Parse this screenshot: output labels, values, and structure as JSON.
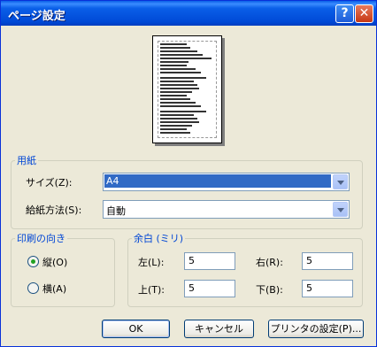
{
  "window": {
    "title": "ページ設定"
  },
  "titlebar": {
    "help_glyph": "?",
    "close_glyph": "✕"
  },
  "paper": {
    "legend": "用紙",
    "size_label": "サイズ(Z):",
    "size_value": "A4",
    "source_label": "給紙方法(S):",
    "source_value": "自動"
  },
  "orientation": {
    "legend": "印刷の向き",
    "portrait_label": "縦(O)",
    "landscape_label": "横(A)",
    "selected": "portrait"
  },
  "margins": {
    "legend": "余白 (ミリ)",
    "left_label": "左(L):",
    "left_value": "5",
    "right_label": "右(R):",
    "right_value": "5",
    "top_label": "上(T):",
    "top_value": "5",
    "bottom_label": "下(B):",
    "bottom_value": "5"
  },
  "buttons": {
    "ok": "OK",
    "cancel": "キャンセル",
    "printer": "プリンタの設定(P)..."
  }
}
